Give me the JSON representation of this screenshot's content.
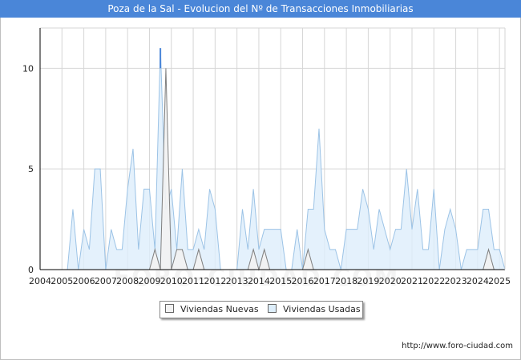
{
  "chart_data": {
    "type": "area",
    "title": "Poza de la Sal - Evolucion del Nº de Transacciones Inmobiliarias",
    "xlabel": "",
    "ylabel": "",
    "xlim": [
      2004,
      2025.25
    ],
    "ylim": [
      0,
      12
    ],
    "yticks": [
      0,
      5,
      10
    ],
    "xticks": [
      2004,
      2005,
      2006,
      2007,
      2008,
      2009,
      2010,
      2011,
      2012,
      2013,
      2014,
      2015,
      2016,
      2017,
      2018,
      2019,
      2020,
      2021,
      2022,
      2023,
      2024,
      2025
    ],
    "grid": true,
    "legend_position": "bottom-center",
    "x": [
      2005.0,
      2005.25,
      2005.5,
      2005.75,
      2006.0,
      2006.25,
      2006.5,
      2006.75,
      2007.0,
      2007.25,
      2007.5,
      2007.75,
      2008.0,
      2008.25,
      2008.5,
      2008.75,
      2009.0,
      2009.25,
      2009.5,
      2009.75,
      2010.0,
      2010.25,
      2010.5,
      2010.75,
      2011.0,
      2011.25,
      2011.5,
      2011.75,
      2012.0,
      2012.25,
      2012.5,
      2012.75,
      2013.0,
      2013.25,
      2013.5,
      2013.75,
      2014.0,
      2014.25,
      2014.5,
      2014.75,
      2015.0,
      2015.25,
      2015.5,
      2015.75,
      2016.0,
      2016.25,
      2016.5,
      2016.75,
      2017.0,
      2017.25,
      2017.5,
      2017.75,
      2018.0,
      2018.25,
      2018.5,
      2018.75,
      2019.0,
      2019.25,
      2019.5,
      2019.75,
      2020.0,
      2020.25,
      2020.5,
      2020.75,
      2021.0,
      2021.25,
      2021.5,
      2021.75,
      2022.0,
      2022.25,
      2022.5,
      2022.75,
      2023.0,
      2023.25,
      2023.5,
      2023.75,
      2024.0,
      2024.25,
      2024.5,
      2024.75,
      2025.0,
      2025.25
    ],
    "series": [
      {
        "name": "Viviendas Nuevas",
        "color": "#7f7f7f",
        "fill": "#f2f2f2",
        "values": [
          0,
          0,
          0,
          0,
          0,
          0,
          0,
          0,
          0,
          0,
          0,
          0,
          0,
          0,
          0,
          0,
          0,
          1,
          0,
          10,
          0,
          1,
          1,
          0,
          0,
          1,
          0,
          0,
          0,
          0,
          0,
          0,
          0,
          0,
          0,
          1,
          0,
          1,
          0,
          0,
          0,
          0,
          0,
          0,
          0,
          1,
          0,
          0,
          0,
          0,
          0,
          0,
          0,
          0,
          0,
          0,
          0,
          0,
          0,
          0,
          0,
          0,
          0,
          0,
          0,
          0,
          0,
          0,
          0,
          0,
          0,
          0,
          0,
          0,
          0,
          0,
          0,
          0,
          1,
          0,
          0,
          0
        ]
      },
      {
        "name": "Viviendas Usadas",
        "color": "#9cc3e6",
        "fill": "#ddeefb",
        "values": [
          0,
          0,
          3,
          0,
          2,
          1,
          5,
          5,
          0,
          2,
          1,
          1,
          4,
          6,
          1,
          4,
          4,
          1,
          11,
          3,
          4,
          1,
          5,
          1,
          1,
          2,
          1,
          4,
          3,
          0,
          0,
          0,
          0,
          3,
          1,
          4,
          1,
          2,
          2,
          2,
          2,
          0,
          0,
          2,
          0,
          3,
          3,
          7,
          2,
          1,
          1,
          0,
          2,
          2,
          2,
          4,
          3,
          1,
          3,
          2,
          1,
          2,
          2,
          5,
          2,
          4,
          1,
          1,
          4,
          0,
          2,
          3,
          2,
          0,
          1,
          1,
          1,
          3,
          3,
          1,
          1,
          0
        ]
      }
    ],
    "peak_marker_color": "#4a86d8"
  },
  "legend": {
    "nuevas_label": "Viviendas Nuevas",
    "usadas_label": "Viviendas Usadas"
  },
  "source": "http://www.foro-ciudad.com",
  "watermark": "FORO-CIUDAD.COM"
}
